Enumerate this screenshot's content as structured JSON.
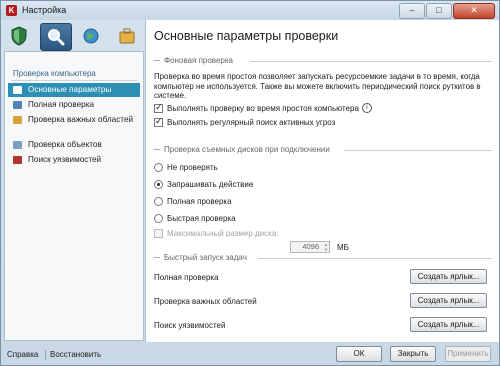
{
  "window": {
    "title": "Настройка"
  },
  "sidebar": {
    "section_label": "Проверка компьютера",
    "items": [
      {
        "label": "Основные параметры",
        "selected": true
      },
      {
        "label": "Полная проверка"
      },
      {
        "label": "Проверка важных областей"
      },
      {
        "label": "Проверка объектов"
      },
      {
        "label": "Поиск уязвимостей"
      }
    ]
  },
  "main": {
    "title": "Основные параметры проверки",
    "background_group": {
      "title": "Фоновая проверка",
      "description": "Проверка во время простоя позволяет запускать ресурсоемкие задачи в то время, когда компьютер не используется. Также вы можете включить периодический поиск руткитов в системе.",
      "idle_scan_label": "Выполнять проверку во время простоя компьютера",
      "active_threats_label": "Выполнять регулярный поиск активных угроз"
    },
    "removable_group": {
      "title": "Проверка съемных дисков при подключении",
      "options": [
        "Не проверять",
        "Запрашивать действие",
        "Полная проверка",
        "Быстрая проверка"
      ],
      "selected": "Запрашивать действие",
      "max_size_label": "Максимальный размер диска:",
      "max_size_value": "4096",
      "max_size_unit": "МБ"
    },
    "quick_launch_group": {
      "title": "Быстрый запуск задач",
      "tasks": [
        {
          "label": "Полная проверка",
          "button": "Создать ярлык..."
        },
        {
          "label": "Проверка важных областей",
          "button": "Создать ярлык..."
        },
        {
          "label": "Поиск уязвимостей",
          "button": "Создать ярлык..."
        }
      ]
    }
  },
  "footer": {
    "help_link": "Справка",
    "restore_link": "Восстановить",
    "ok_button": "ОК",
    "close_button": "Закрыть",
    "apply_button": "Применить"
  }
}
